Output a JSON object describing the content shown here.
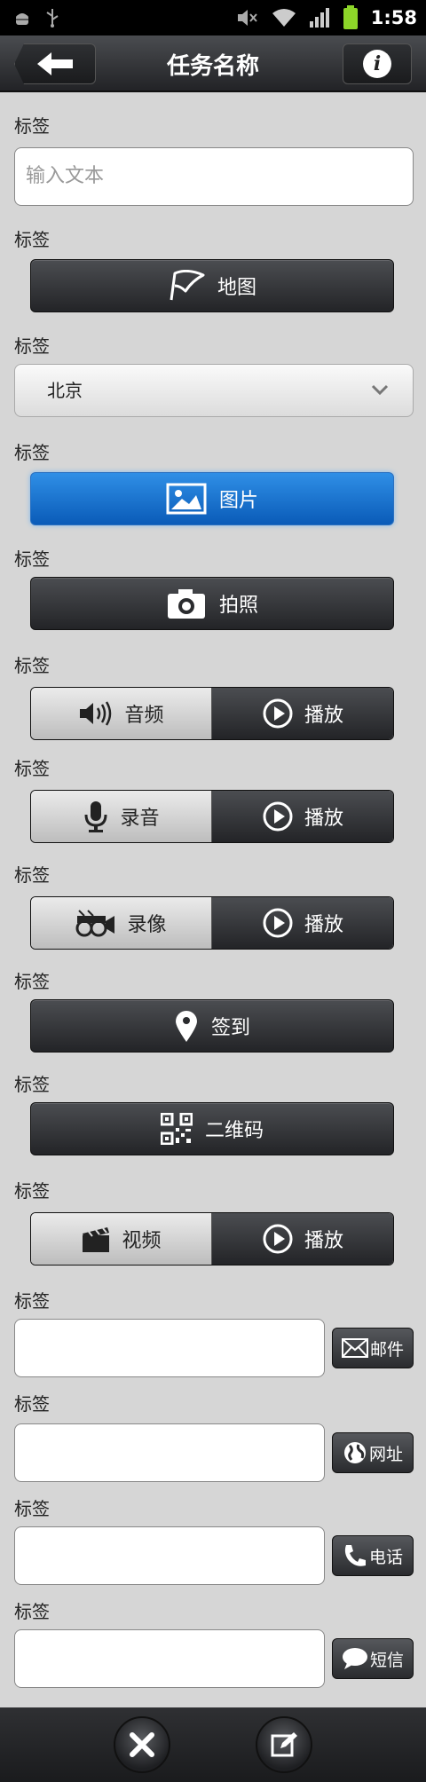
{
  "status_bar": {
    "time": "1:58",
    "icons": [
      "android-debug-icon",
      "usb-icon",
      "mute-icon",
      "wifi-icon",
      "signal-icon",
      "battery-icon"
    ]
  },
  "header": {
    "title": "任务名称",
    "back_icon": "arrow-left-icon",
    "info_icon": "info-icon",
    "info_glyph": "i"
  },
  "fields": [
    {
      "label": "标签",
      "type": "text",
      "placeholder": "输入文本"
    },
    {
      "label": "标签",
      "type": "button",
      "text": "地图",
      "icon": "map-flag-icon"
    },
    {
      "label": "标签",
      "type": "select",
      "value": "北京"
    },
    {
      "label": "标签",
      "type": "button",
      "text": "图片",
      "icon": "image-icon",
      "selected": true
    },
    {
      "label": "标签",
      "type": "button",
      "text": "拍照",
      "icon": "camera-icon"
    },
    {
      "label": "标签",
      "type": "split",
      "left": "音频",
      "left_icon": "speaker-icon",
      "right": "播放",
      "right_icon": "play-icon"
    },
    {
      "label": "标签",
      "type": "split",
      "left": "录音",
      "left_icon": "microphone-icon",
      "right": "播放",
      "right_icon": "play-icon"
    },
    {
      "label": "标签",
      "type": "split",
      "left": "录像",
      "left_icon": "video-camera-icon",
      "right": "播放",
      "right_icon": "play-icon"
    },
    {
      "label": "标签",
      "type": "button",
      "text": "签到",
      "icon": "location-pin-icon"
    },
    {
      "label": "标签",
      "type": "button",
      "text": "二维码",
      "icon": "qr-code-icon"
    },
    {
      "label": "标签",
      "type": "split",
      "left": "视频",
      "left_icon": "clapperboard-icon",
      "right": "播放",
      "right_icon": "play-icon"
    },
    {
      "label": "标签",
      "type": "input-action",
      "value": "",
      "action": "邮件",
      "action_icon": "mail-icon"
    },
    {
      "label": "标签",
      "type": "input-action",
      "value": "",
      "action": "网址",
      "action_icon": "globe-icon"
    },
    {
      "label": "标签",
      "type": "input-action",
      "value": "",
      "action": "电话",
      "action_icon": "phone-icon"
    },
    {
      "label": "标签",
      "type": "input-action",
      "value": "",
      "action": "短信",
      "action_icon": "sms-bubble-icon"
    }
  ],
  "footer": {
    "cancel_icon": "close-icon",
    "edit_icon": "edit-icon",
    "cancel_glyph": "✕"
  },
  "colors": {
    "accent_blue": "#0a5bb8",
    "dark_button": "#2a2b2e",
    "background": "#d6d6d6"
  }
}
